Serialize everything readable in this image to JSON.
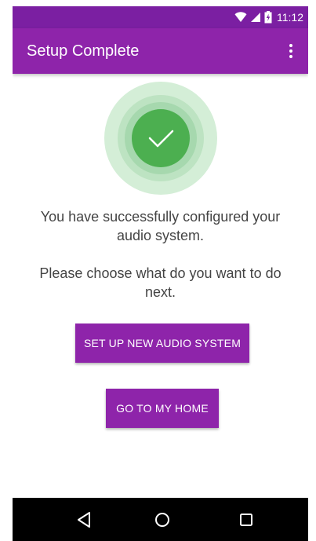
{
  "status_bar": {
    "time": "11:12",
    "icons": [
      "wifi-icon",
      "signal-icon",
      "battery-icon"
    ]
  },
  "app_bar": {
    "title": "Setup Complete",
    "overflow_icon": "more-vert-icon"
  },
  "content": {
    "success_icon": "check-icon",
    "message_success": "You have successfully configured your audio system.",
    "message_prompt": "Please choose what do you want to do next.",
    "primary_button_label": "SET UP NEW AUDIO SYSTEM",
    "secondary_button_label": "GO TO MY HOME"
  },
  "nav_bar": {
    "icons": [
      "back-icon",
      "home-icon",
      "recents-icon"
    ]
  },
  "colors": {
    "status_bar": "#7b1fa2",
    "app_bar": "#8e24aa",
    "button": "#8e24aa",
    "success_green": "#4caf50",
    "text": "#444444",
    "nav_bar": "#000000"
  }
}
